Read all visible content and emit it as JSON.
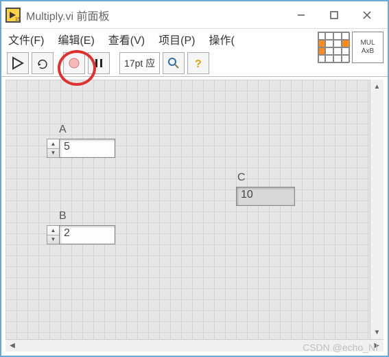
{
  "window": {
    "title": "Multiply.vi 前面板"
  },
  "menu": {
    "file": "文件(F)",
    "edit": "编辑(E)",
    "view": "查看(V)",
    "project": "项目(P)",
    "operate": "操作("
  },
  "toolbar": {
    "font_label": "17pt 应"
  },
  "vi_icon": {
    "line1": "MUL",
    "line2": "AxB"
  },
  "controls": {
    "a": {
      "label": "A",
      "value": "5"
    },
    "b": {
      "label": "B",
      "value": "2"
    },
    "c": {
      "label": "C",
      "value": "10"
    }
  },
  "watermark": "CSDN @echo_NI"
}
